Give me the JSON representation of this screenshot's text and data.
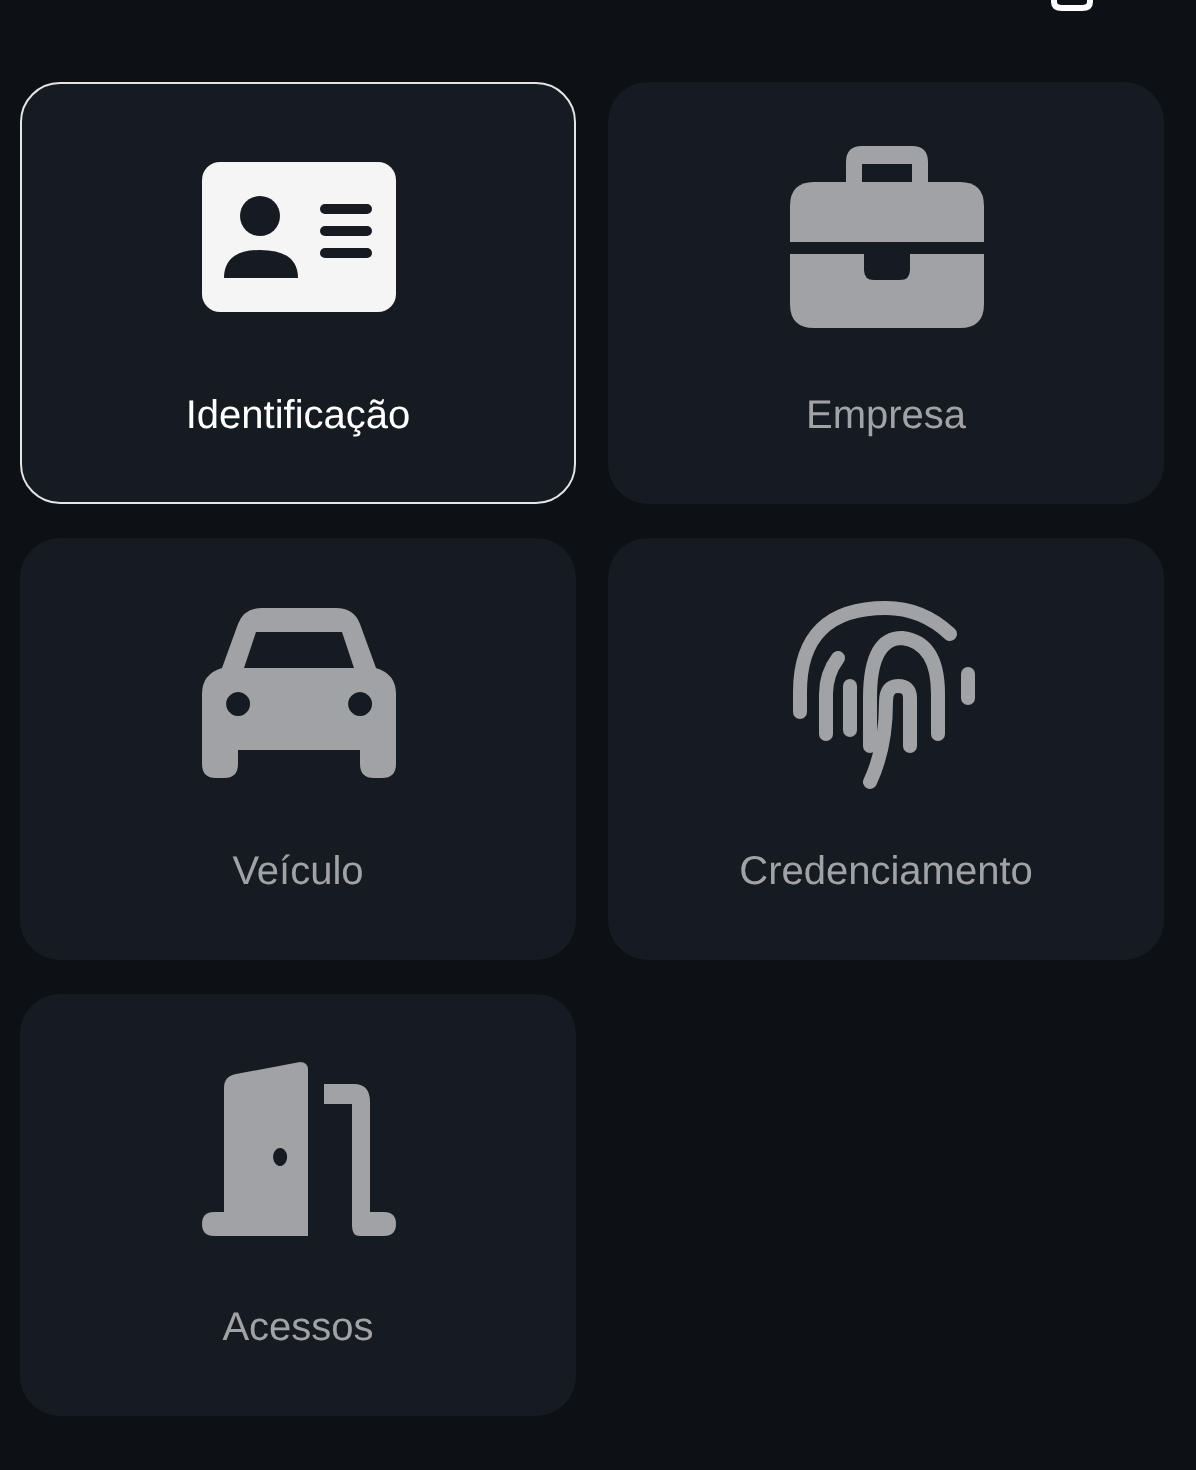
{
  "tiles": [
    {
      "label": "Identificação",
      "selected": true
    },
    {
      "label": "Empresa",
      "selected": false
    },
    {
      "label": "Veículo",
      "selected": false
    },
    {
      "label": "Credenciamento",
      "selected": false
    },
    {
      "label": "Acessos",
      "selected": false
    }
  ]
}
